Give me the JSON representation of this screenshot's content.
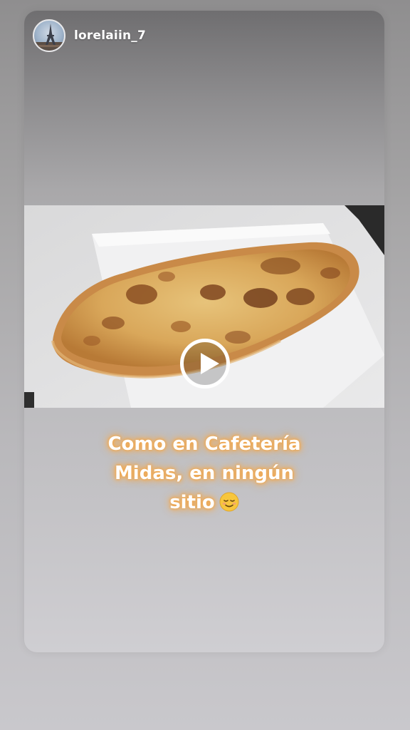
{
  "story": {
    "username": "lorelaiin_7",
    "caption_lines": [
      "Como en Cafetería",
      "Midas, en ningún",
      "sitio"
    ],
    "emoji": "relieved-face-icon"
  },
  "colors": {
    "caption_glow": "#f2a74e",
    "text": "#ffffff"
  }
}
